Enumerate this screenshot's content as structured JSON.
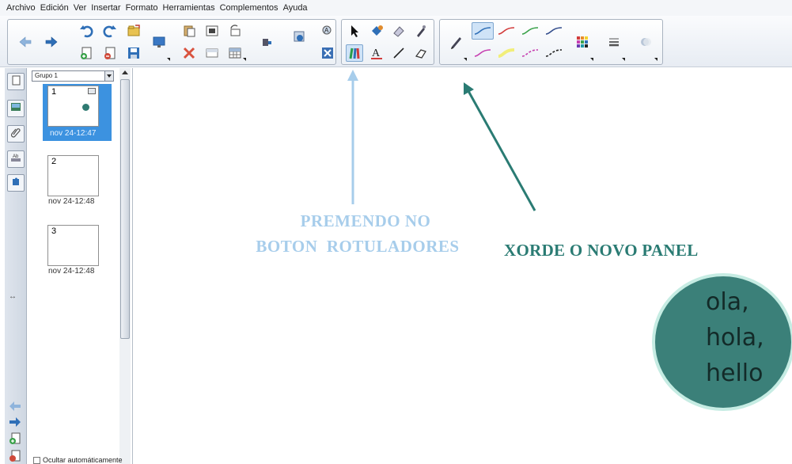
{
  "menu": [
    "Archivo",
    "Edición",
    "Ver",
    "Insertar",
    "Formato",
    "Herramientas",
    "Complementos",
    "Ayuda"
  ],
  "sidebar": {
    "group_select": "Grupo 1",
    "pages": [
      {
        "number": "1",
        "timestamp": "nov 24-12:47",
        "selected": true
      },
      {
        "number": "2",
        "timestamp": "nov 24-12:48",
        "selected": false
      },
      {
        "number": "3",
        "timestamp": "nov 24-12:48",
        "selected": false
      }
    ],
    "hide_checkbox_label": "Ocultar automáticamente"
  },
  "canvas": {
    "annotation_left_line1": "PREMENDO NO",
    "annotation_left_line2": "BOTON  ROTULADORES",
    "annotation_right": "XORDE O NOVO PANEL",
    "bubble_lines": [
      "ola,",
      "hola,",
      "hello"
    ]
  },
  "colors": {
    "annotation_left": "#a7cdeb",
    "annotation_right": "#2a7b73",
    "bubble_fill": "#3b8079",
    "bubble_border": "#c6ece3",
    "selected_page": "#3c92e0"
  },
  "icons": {
    "toolbar": [
      "back-arrow-icon",
      "forward-arrow-icon",
      "undo-icon",
      "redo-icon",
      "open-folder-icon",
      "new-page-icon",
      "delete-page-icon",
      "save-icon",
      "screen-icon",
      "paste-icon",
      "delete-icon",
      "image-icon",
      "reveal-icon",
      "rotate-icon",
      "table-icon",
      "document-camera-icon",
      "capture-icon",
      "recognize-icon",
      "close-box-icon",
      "select-icon",
      "fill-icon",
      "eraser-icon",
      "magic-pen-icon",
      "pens-icon",
      "text-icon",
      "line-icon",
      "shape-icon",
      "pencil-icon",
      "color-palette-icon",
      "line-width-icon",
      "transparency-icon"
    ]
  }
}
